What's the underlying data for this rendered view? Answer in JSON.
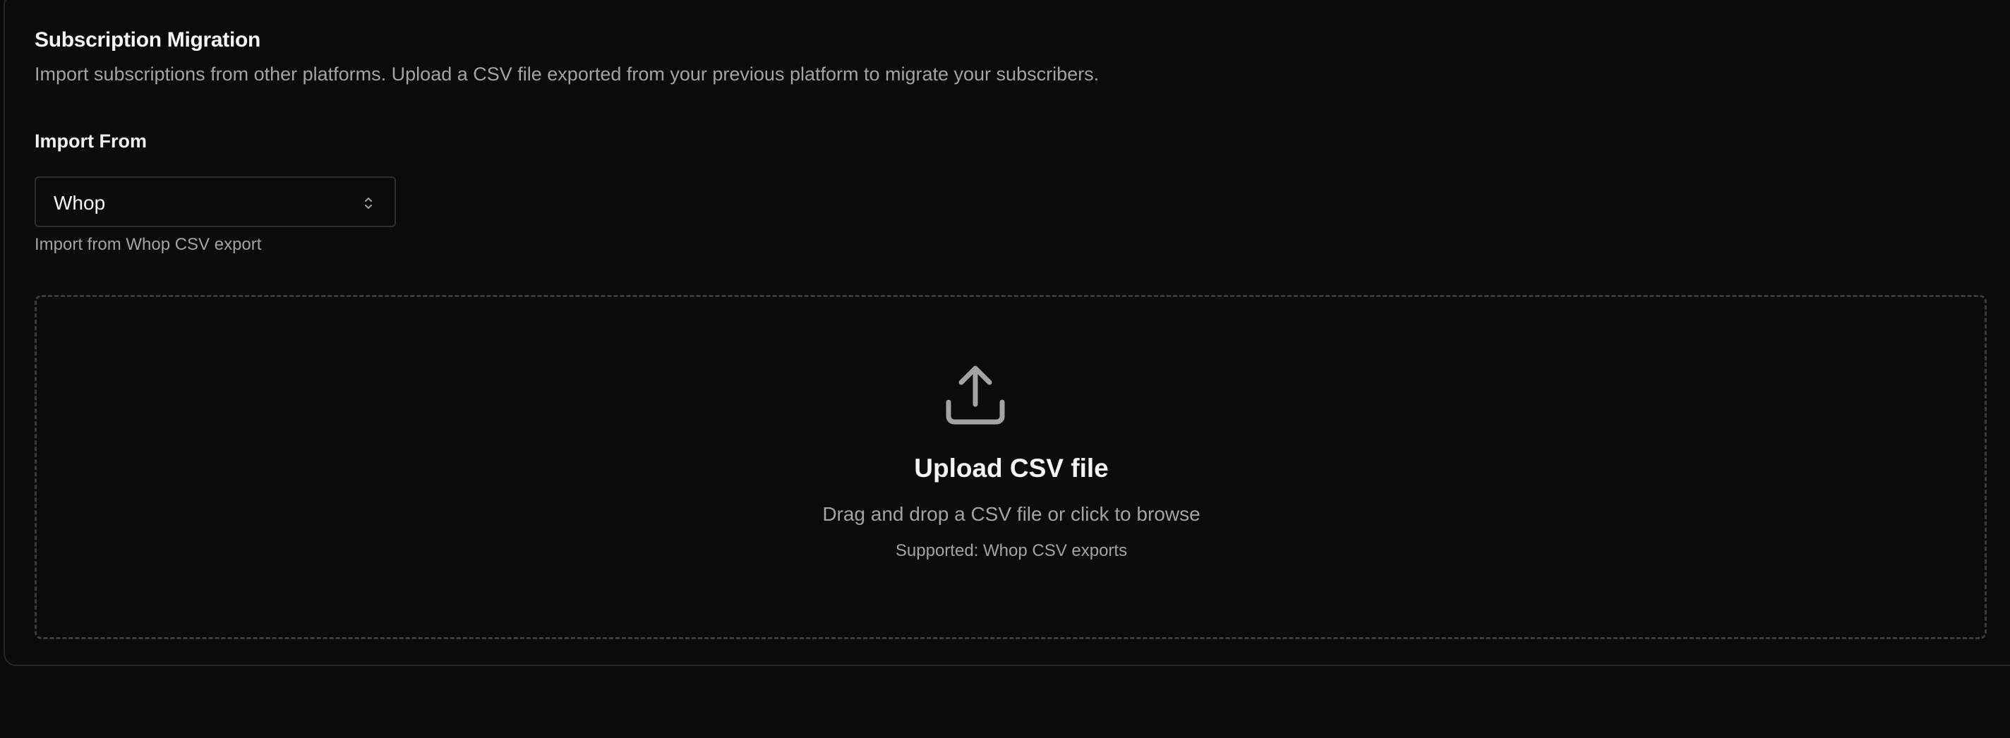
{
  "section": {
    "title": "Subscription Migration",
    "description": "Import subscriptions from other platforms. Upload a CSV file exported from your previous platform to migrate your subscribers."
  },
  "import_from": {
    "label": "Import From",
    "selected": "Whop",
    "helper": "Import from Whop CSV export"
  },
  "upload": {
    "icon": "upload-icon",
    "title": "Upload CSV file",
    "subtitle": "Drag and drop a CSV file or click to browse",
    "supported": "Supported: Whop CSV exports"
  },
  "colors": {
    "background": "#0a0a0a",
    "border": "#262626",
    "text_primary": "#f5f5f5",
    "text_muted": "#a3a3a3"
  }
}
